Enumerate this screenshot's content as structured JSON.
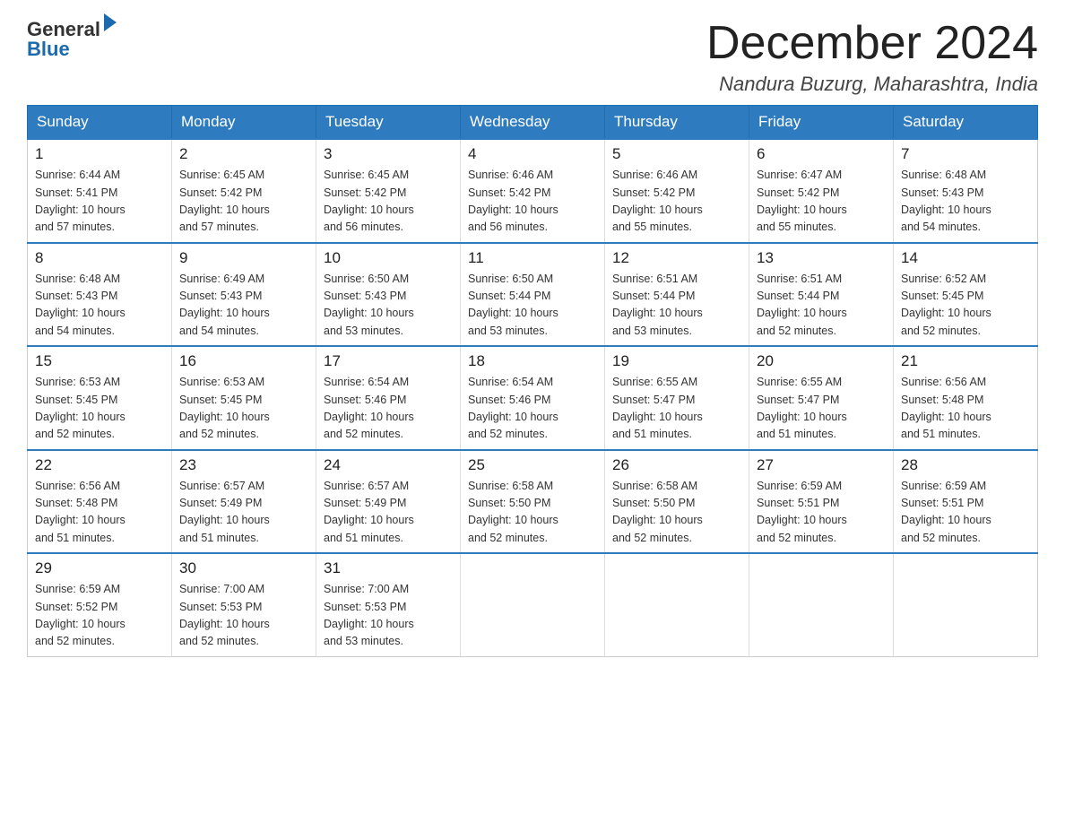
{
  "logo": {
    "general": "General",
    "blue": "Blue"
  },
  "title": "December 2024",
  "location": "Nandura Buzurg, Maharashtra, India",
  "weekdays": [
    "Sunday",
    "Monday",
    "Tuesday",
    "Wednesday",
    "Thursday",
    "Friday",
    "Saturday"
  ],
  "weeks": [
    [
      {
        "day": "1",
        "info": "Sunrise: 6:44 AM\nSunset: 5:41 PM\nDaylight: 10 hours\nand 57 minutes."
      },
      {
        "day": "2",
        "info": "Sunrise: 6:45 AM\nSunset: 5:42 PM\nDaylight: 10 hours\nand 57 minutes."
      },
      {
        "day": "3",
        "info": "Sunrise: 6:45 AM\nSunset: 5:42 PM\nDaylight: 10 hours\nand 56 minutes."
      },
      {
        "day": "4",
        "info": "Sunrise: 6:46 AM\nSunset: 5:42 PM\nDaylight: 10 hours\nand 56 minutes."
      },
      {
        "day": "5",
        "info": "Sunrise: 6:46 AM\nSunset: 5:42 PM\nDaylight: 10 hours\nand 55 minutes."
      },
      {
        "day": "6",
        "info": "Sunrise: 6:47 AM\nSunset: 5:42 PM\nDaylight: 10 hours\nand 55 minutes."
      },
      {
        "day": "7",
        "info": "Sunrise: 6:48 AM\nSunset: 5:43 PM\nDaylight: 10 hours\nand 54 minutes."
      }
    ],
    [
      {
        "day": "8",
        "info": "Sunrise: 6:48 AM\nSunset: 5:43 PM\nDaylight: 10 hours\nand 54 minutes."
      },
      {
        "day": "9",
        "info": "Sunrise: 6:49 AM\nSunset: 5:43 PM\nDaylight: 10 hours\nand 54 minutes."
      },
      {
        "day": "10",
        "info": "Sunrise: 6:50 AM\nSunset: 5:43 PM\nDaylight: 10 hours\nand 53 minutes."
      },
      {
        "day": "11",
        "info": "Sunrise: 6:50 AM\nSunset: 5:44 PM\nDaylight: 10 hours\nand 53 minutes."
      },
      {
        "day": "12",
        "info": "Sunrise: 6:51 AM\nSunset: 5:44 PM\nDaylight: 10 hours\nand 53 minutes."
      },
      {
        "day": "13",
        "info": "Sunrise: 6:51 AM\nSunset: 5:44 PM\nDaylight: 10 hours\nand 52 minutes."
      },
      {
        "day": "14",
        "info": "Sunrise: 6:52 AM\nSunset: 5:45 PM\nDaylight: 10 hours\nand 52 minutes."
      }
    ],
    [
      {
        "day": "15",
        "info": "Sunrise: 6:53 AM\nSunset: 5:45 PM\nDaylight: 10 hours\nand 52 minutes."
      },
      {
        "day": "16",
        "info": "Sunrise: 6:53 AM\nSunset: 5:45 PM\nDaylight: 10 hours\nand 52 minutes."
      },
      {
        "day": "17",
        "info": "Sunrise: 6:54 AM\nSunset: 5:46 PM\nDaylight: 10 hours\nand 52 minutes."
      },
      {
        "day": "18",
        "info": "Sunrise: 6:54 AM\nSunset: 5:46 PM\nDaylight: 10 hours\nand 52 minutes."
      },
      {
        "day": "19",
        "info": "Sunrise: 6:55 AM\nSunset: 5:47 PM\nDaylight: 10 hours\nand 51 minutes."
      },
      {
        "day": "20",
        "info": "Sunrise: 6:55 AM\nSunset: 5:47 PM\nDaylight: 10 hours\nand 51 minutes."
      },
      {
        "day": "21",
        "info": "Sunrise: 6:56 AM\nSunset: 5:48 PM\nDaylight: 10 hours\nand 51 minutes."
      }
    ],
    [
      {
        "day": "22",
        "info": "Sunrise: 6:56 AM\nSunset: 5:48 PM\nDaylight: 10 hours\nand 51 minutes."
      },
      {
        "day": "23",
        "info": "Sunrise: 6:57 AM\nSunset: 5:49 PM\nDaylight: 10 hours\nand 51 minutes."
      },
      {
        "day": "24",
        "info": "Sunrise: 6:57 AM\nSunset: 5:49 PM\nDaylight: 10 hours\nand 51 minutes."
      },
      {
        "day": "25",
        "info": "Sunrise: 6:58 AM\nSunset: 5:50 PM\nDaylight: 10 hours\nand 52 minutes."
      },
      {
        "day": "26",
        "info": "Sunrise: 6:58 AM\nSunset: 5:50 PM\nDaylight: 10 hours\nand 52 minutes."
      },
      {
        "day": "27",
        "info": "Sunrise: 6:59 AM\nSunset: 5:51 PM\nDaylight: 10 hours\nand 52 minutes."
      },
      {
        "day": "28",
        "info": "Sunrise: 6:59 AM\nSunset: 5:51 PM\nDaylight: 10 hours\nand 52 minutes."
      }
    ],
    [
      {
        "day": "29",
        "info": "Sunrise: 6:59 AM\nSunset: 5:52 PM\nDaylight: 10 hours\nand 52 minutes."
      },
      {
        "day": "30",
        "info": "Sunrise: 7:00 AM\nSunset: 5:53 PM\nDaylight: 10 hours\nand 52 minutes."
      },
      {
        "day": "31",
        "info": "Sunrise: 7:00 AM\nSunset: 5:53 PM\nDaylight: 10 hours\nand 53 minutes."
      },
      {
        "day": "",
        "info": ""
      },
      {
        "day": "",
        "info": ""
      },
      {
        "day": "",
        "info": ""
      },
      {
        "day": "",
        "info": ""
      }
    ]
  ]
}
